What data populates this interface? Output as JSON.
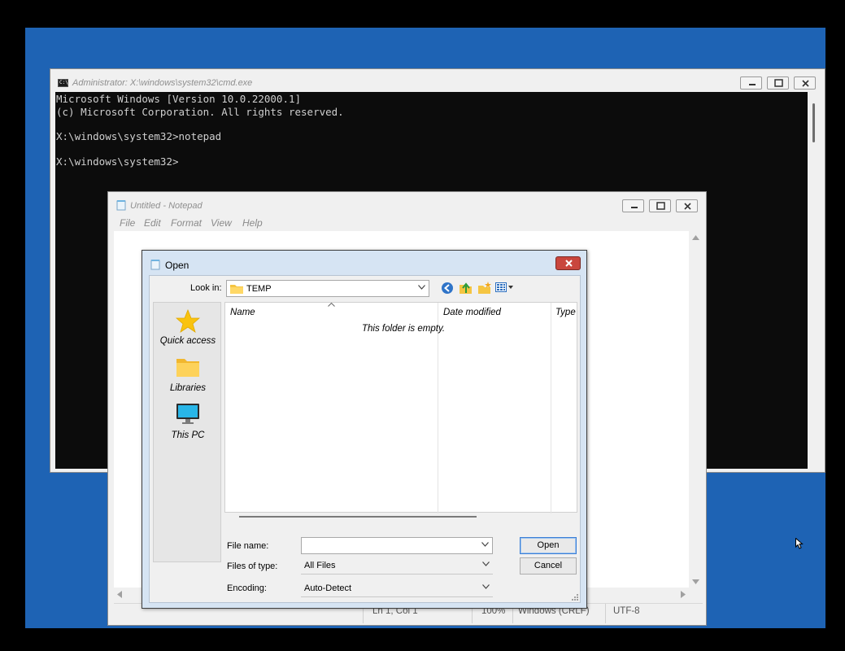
{
  "cmd": {
    "title": "Administrator: X:\\windows\\system32\\cmd.exe",
    "lines": [
      "Microsoft Windows [Version 10.0.22000.1]",
      "(c) Microsoft Corporation. All rights reserved.",
      "",
      "X:\\windows\\system32>notepad",
      "",
      "X:\\windows\\system32>"
    ]
  },
  "notepad": {
    "title": "Untitled - Notepad",
    "menu": [
      "File",
      "Edit",
      "Format",
      "View",
      "Help"
    ],
    "status": {
      "position": "Ln 1, Col 1",
      "zoom": "100%",
      "line_ending": "Windows (CRLF)",
      "encoding": "UTF-8"
    }
  },
  "open_dialog": {
    "title": "Open",
    "look_in_label": "Look in:",
    "look_in_value": "TEMP",
    "places": [
      {
        "label": "Quick access",
        "icon": "star-icon"
      },
      {
        "label": "Libraries",
        "icon": "folder-icon"
      },
      {
        "label": "This PC",
        "icon": "monitor-icon"
      }
    ],
    "columns": [
      "Name",
      "Date modified",
      "Type"
    ],
    "empty_message": "This folder is empty.",
    "file_name_label": "File name:",
    "file_name_value": "",
    "files_of_type_label": "Files of type:",
    "files_of_type_value": "All Files",
    "encoding_label": "Encoding:",
    "encoding_value": "Auto-Detect",
    "open_button": "Open",
    "cancel_button": "Cancel"
  },
  "colors": {
    "desktop": "#1e63b4",
    "console_bg": "#0c0c0c",
    "close_red": "#c9463d"
  }
}
